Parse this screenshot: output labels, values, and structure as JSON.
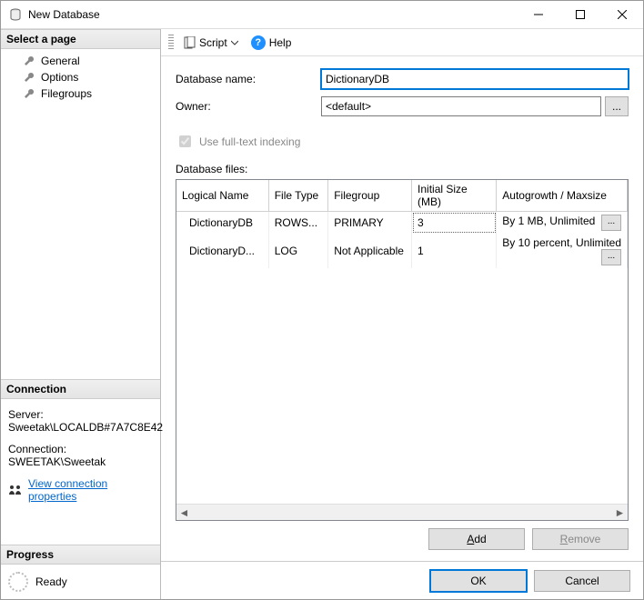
{
  "window": {
    "title": "New Database"
  },
  "leftpane": {
    "select_page_header": "Select a page",
    "pages": [
      {
        "label": "General"
      },
      {
        "label": "Options"
      },
      {
        "label": "Filegroups"
      }
    ],
    "connection_header": "Connection",
    "server_label": "Server:",
    "server_value": "Sweetak\\LOCALDB#7A7C8E42",
    "connection_label": "Connection:",
    "connection_value": "SWEETAK\\Sweetak",
    "view_props": "View connection properties",
    "progress_header": "Progress",
    "progress_status": "Ready"
  },
  "toolbar": {
    "script": "Script",
    "help": "Help"
  },
  "form": {
    "dbname_label": "Database name:",
    "dbname_value": "DictionaryDB",
    "owner_label": "Owner:",
    "owner_value": "<default>",
    "fulltext_label": "Use full-text indexing",
    "files_label": "Database files:"
  },
  "grid": {
    "headers": {
      "logical_name": "Logical Name",
      "file_type": "File Type",
      "filegroup": "Filegroup",
      "initial_size": "Initial Size (MB)",
      "autogrowth": "Autogrowth / Maxsize"
    },
    "rows": [
      {
        "logical_name": "DictionaryDB",
        "file_type": "ROWS...",
        "filegroup": "PRIMARY",
        "initial_size": "3",
        "autogrowth": "By 1 MB, Unlimited"
      },
      {
        "logical_name": "DictionaryD...",
        "file_type": "LOG",
        "filegroup": "Not Applicable",
        "initial_size": "1",
        "autogrowth": "By 10 percent, Unlimited"
      }
    ]
  },
  "buttons": {
    "add": "Add",
    "remove": "Remove",
    "ok": "OK",
    "cancel": "Cancel",
    "ellipsis": "..."
  }
}
